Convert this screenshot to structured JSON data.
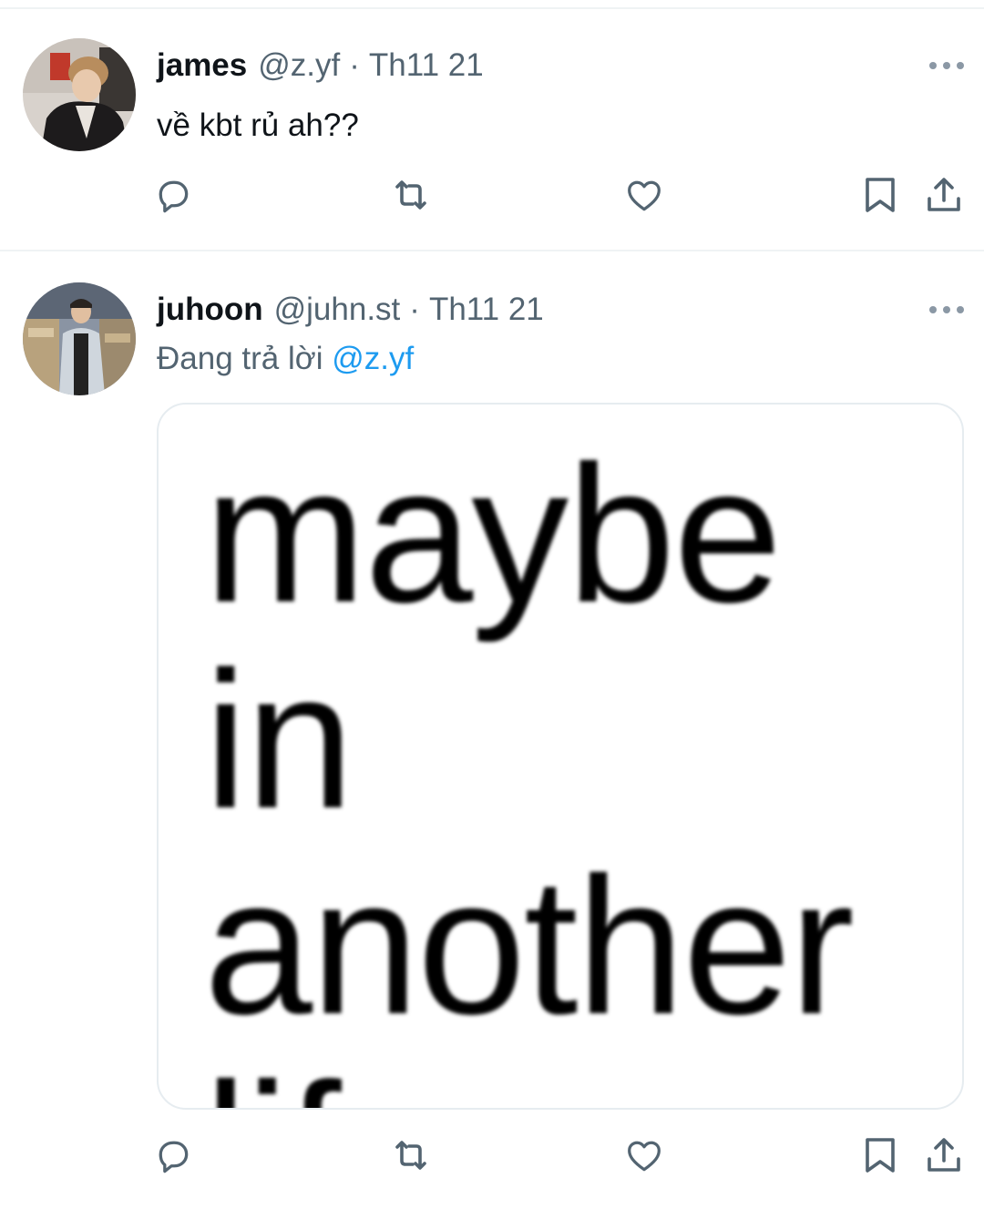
{
  "tweets": [
    {
      "author": {
        "name": "james",
        "handle": "@z.yf",
        "separator": "·",
        "time": "Th11 21",
        "avatar": "profile-photo-leather-jacket"
      },
      "text": "về kbt rủ ah??",
      "actions": {
        "reply": "reply-icon",
        "retweet": "retweet-icon",
        "like": "heart-icon",
        "bookmark": "bookmark-icon",
        "share": "share-icon"
      }
    },
    {
      "author": {
        "name": "juhoon",
        "handle": "@juhn.st",
        "separator": "·",
        "time": "Th11 21",
        "avatar": "profile-photo-record-store"
      },
      "reply_context": {
        "prefix": "Đang trả lời",
        "mention": "@z.yf"
      },
      "media": {
        "image_text": "maybe in\nanother\nlife"
      },
      "actions": {
        "reply": "reply-icon",
        "retweet": "retweet-icon",
        "like": "heart-icon",
        "bookmark": "bookmark-icon",
        "share": "share-icon"
      }
    }
  ],
  "colors": {
    "text_primary": "#0f1419",
    "text_secondary": "#536471",
    "link": "#1d9bf0",
    "divider": "#eff3f4"
  }
}
